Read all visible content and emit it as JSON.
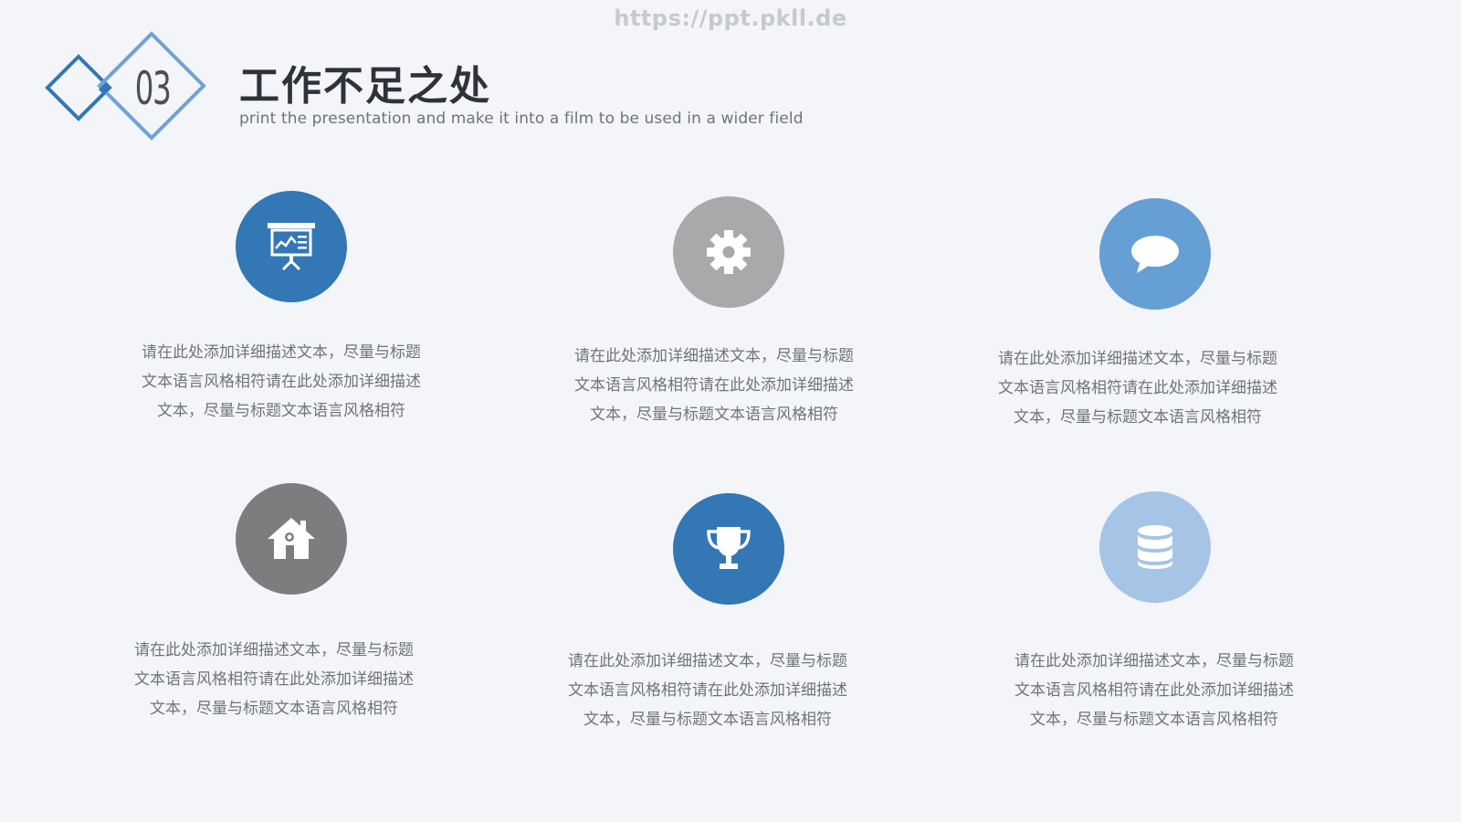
{
  "watermark": "https://ppt.pkll.de",
  "header": {
    "section_number": "03",
    "title": "工作不足之处",
    "subtitle": "print the presentation and make it into a film to be used in a wider field"
  },
  "colors": {
    "dark_blue": "#3377b5",
    "gray": "#a9a9ab",
    "mid_blue": "#659fd4",
    "dark_gray": "#7d7d7f",
    "light_blue": "#a6c4e6"
  },
  "items": [
    {
      "icon": "presentation-board-icon",
      "text": "请在此处添加详细描述文本，尽量与标题文本语言风格相符请在此处添加详细描述文本，尽量与标题文本语言风格相符"
    },
    {
      "icon": "gear-icon",
      "text": "请在此处添加详细描述文本，尽量与标题文本语言风格相符请在此处添加详细描述文本，尽量与标题文本语言风格相符"
    },
    {
      "icon": "speech-bubble-icon",
      "text": "请在此处添加详细描述文本，尽量与标题文本语言风格相符请在此处添加详细描述文本，尽量与标题文本语言风格相符"
    },
    {
      "icon": "house-icon",
      "text": "请在此处添加详细描述文本，尽量与标题文本语言风格相符请在此处添加详细描述文本，尽量与标题文本语言风格相符"
    },
    {
      "icon": "trophy-icon",
      "text": "请在此处添加详细描述文本，尽量与标题文本语言风格相符请在此处添加详细描述文本，尽量与标题文本语言风格相符"
    },
    {
      "icon": "database-icon",
      "text": "请在此处添加详细描述文本，尽量与标题文本语言风格相符请在此处添加详细描述文本，尽量与标题文本语言风格相符"
    }
  ]
}
